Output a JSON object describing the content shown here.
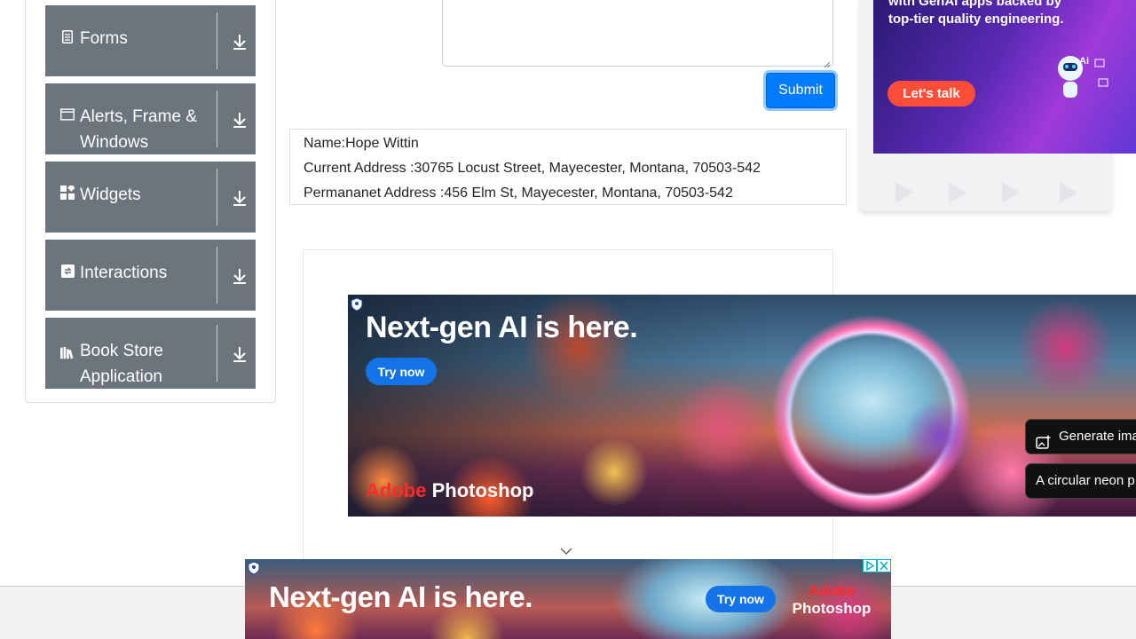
{
  "sidebar": {
    "items": [
      {
        "label": "Forms",
        "icon": "document-icon"
      },
      {
        "label": "Alerts, Frame & Windows",
        "icon": "window-icon"
      },
      {
        "label": "Widgets",
        "icon": "widgets-icon"
      },
      {
        "label": "Interactions",
        "icon": "interactions-icon"
      },
      {
        "label": "Book Store Application",
        "icon": "library-icon"
      }
    ]
  },
  "form": {
    "submit_label": "Submit"
  },
  "output": {
    "name": "Name:Hope Wittin",
    "current_address": "Current Address :30765 Locust Street, Mayecester, Montana, 70503-542",
    "permanent_address": "Permananet Address :456 Elm St, Mayecester, Montana, 70503-542"
  },
  "right_ad": {
    "headline": "with GenAI apps backed by top-tier quality engineering.",
    "cta": "Let's talk",
    "robot_label": "Ai"
  },
  "big_ad": {
    "headline": "Next-gen AI is here.",
    "cta": "Try now",
    "brand_adobe": "Adobe",
    "brand_product": "Photoshop",
    "chip_1": "Generate ima",
    "chip_2": "A circular neon p"
  },
  "bottom_ad": {
    "headline": "Next-gen AI is here.",
    "cta": "Try now",
    "brand_adobe": "Adobe",
    "brand_product": "Photoshop"
  },
  "colors": {
    "menu_bg": "#6c757d",
    "submit_bg": "#007bff",
    "ad_cta_red": "#ff4d3a",
    "ad_cta_blue": "#1473e6"
  }
}
